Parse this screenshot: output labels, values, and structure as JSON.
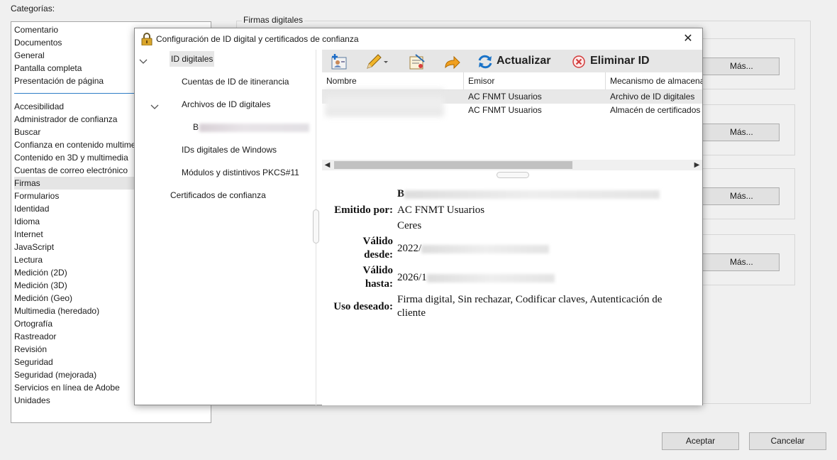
{
  "prefs": {
    "categories_label": "Categorías:",
    "top_items": [
      "Comentario",
      "Documentos",
      "General",
      "Pantalla completa",
      "Presentación de página"
    ],
    "items": [
      "Accesibilidad",
      "Administrador de confianza",
      "Buscar",
      "Confianza en contenido multime",
      "Contenido en 3D y multimedia",
      "Cuentas de correo electrónico",
      "Firmas",
      "Formularios",
      "Identidad",
      "Idioma",
      "Internet",
      "JavaScript",
      "Lectura",
      "Medición (2D)",
      "Medición (3D)",
      "Medición (Geo)",
      "Multimedia (heredado)",
      "Ortografía",
      "Rastreador",
      "Revisión",
      "Seguridad",
      "Seguridad (mejorada)",
      "Servicios en línea de Adobe",
      "Unidades"
    ],
    "selected_item": "Firmas",
    "section_title": "Firmas digitales",
    "more_label": "Más...",
    "ok_label": "Aceptar",
    "cancel_label": "Cancelar"
  },
  "dialog": {
    "title": "Configuración de ID digital y certificados de confianza",
    "close_glyph": "✕",
    "tree": {
      "digital_ids": "ID digitales",
      "roaming": "Cuentas de ID de itinerancia",
      "files": "Archivos de ID digitales",
      "file_entry_prefix": "B",
      "windows": "IDs digitales de Windows",
      "pkcs": "Módulos y distintivos PKCS#11",
      "trusted": "Certificados de confianza"
    },
    "toolbar": {
      "refresh_label": "Actualizar",
      "delete_label": "Eliminar ID"
    },
    "grid": {
      "columns": [
        "Nombre",
        "Emisor",
        "Mecanismo de almacena"
      ],
      "rows": [
        {
          "issuer": "AC FNMT Usuarios",
          "mechanism": "Archivo de ID digitales"
        },
        {
          "issuer": "AC FNMT Usuarios",
          "mechanism": "Almacén de certificados"
        }
      ]
    },
    "details": {
      "name_prefix": "B",
      "issued_by_label": "Emitido por:",
      "issued_by_1": "AC FNMT Usuarios",
      "issued_by_2": "Ceres",
      "valid_from_label_1": "Válido",
      "valid_from_label_2": "desde:",
      "valid_from_prefix": "2022/",
      "valid_to_label_1": "Válido",
      "valid_to_label_2": "hasta:",
      "valid_to_prefix": "2026/1",
      "usage_label": "Uso deseado:",
      "usage_line_1": "Firma digital, Sin rechazar, Codificar claves, Autenticación de",
      "usage_line_2": "cliente"
    }
  }
}
